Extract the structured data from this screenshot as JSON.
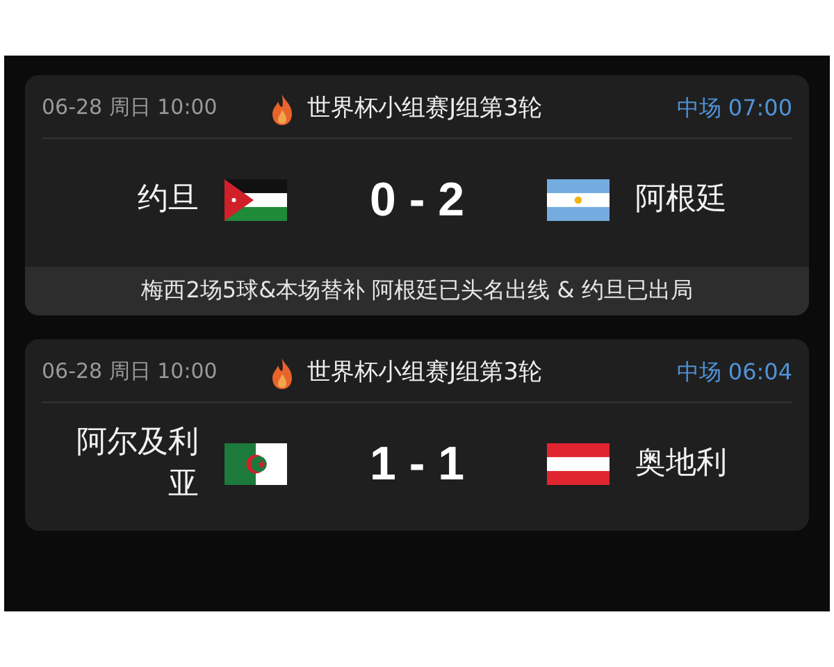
{
  "matches": [
    {
      "datetime": "06-28 周日 10:00",
      "competition": "世界杯小组赛J组第3轮",
      "status": "中场 07:00",
      "home": {
        "name": "约旦",
        "kind": "jordan"
      },
      "score": "0 - 2",
      "away": {
        "name": "阿根廷",
        "kind": "argentina"
      },
      "note": "梅西2场5球&本场替补 阿根廷已头名出线 & 约旦已出局"
    },
    {
      "datetime": "06-28 周日 10:00",
      "competition": "世界杯小组赛J组第3轮",
      "status": "中场 06:04",
      "home": {
        "name": "阿尔及利亚",
        "kind": "algeria"
      },
      "score": "1 - 1",
      "away": {
        "name": "奥地利",
        "kind": "austria"
      }
    }
  ]
}
